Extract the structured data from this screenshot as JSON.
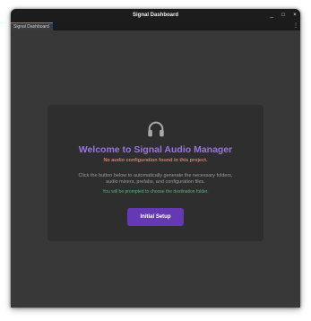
{
  "window": {
    "title": "Signal Dashboard",
    "controls": {
      "minimize": "_",
      "maximize": "□",
      "close": "×"
    }
  },
  "tabs": [
    {
      "label": "Signal Dashboard",
      "active": true
    }
  ],
  "tab_menu_glyph": "⋮",
  "card": {
    "icon": "headphones-icon",
    "title": "Welcome to Signal Audio Manager",
    "warning": "No audio configuration found in this project.",
    "description": "Click the button below to automatically generate the necessary folders, audio mixers, prefabs, and configuration files.",
    "hint": "You will be prompted to choose the destination folder.",
    "button_label": "Initial Setup"
  },
  "colors": {
    "title": "#9b73e4",
    "warning": "#e07a6a",
    "hint": "#5fae7e",
    "button": "#6439b3",
    "tab_accent": "#3f8fd6"
  }
}
